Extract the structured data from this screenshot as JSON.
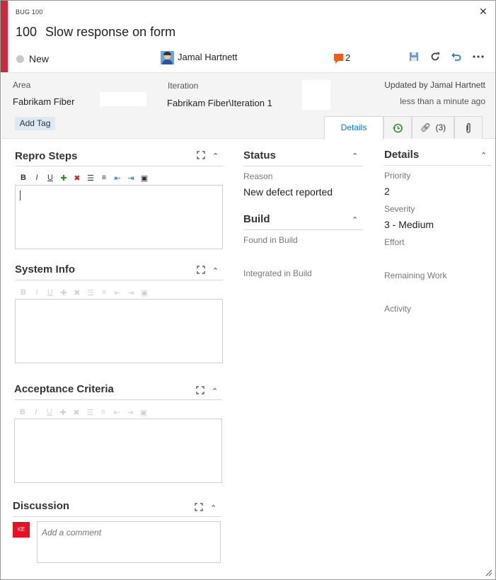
{
  "workitem": {
    "type_label": "BUG 100",
    "id": "100",
    "title": "Slow response on form",
    "state": "New",
    "assigned_to": "Jamal Hartnett",
    "comment_count": "2",
    "accent_color": "#cc293d"
  },
  "toolbar": {
    "close": "✕",
    "icons": [
      "save-icon",
      "refresh-icon",
      "undo-icon",
      "more-icon"
    ]
  },
  "header": {
    "area_label": "Area",
    "area_value": "Fabrikam Fiber",
    "iteration_label": "Iteration",
    "iteration_value": "Fabrikam Fiber\\Iteration 1",
    "updated_by": "Updated by Jamal Hartnett",
    "updated_time": "less than a minute ago",
    "add_tag": "Add Tag"
  },
  "tabs": {
    "details": "Details",
    "links": "(3)"
  },
  "sections": {
    "repro_steps": "Repro Steps",
    "system_info": "System Info",
    "acceptance_criteria": "Acceptance Criteria",
    "discussion": "Discussion"
  },
  "status": {
    "title": "Status",
    "reason_label": "Reason",
    "reason_value": "New defect reported"
  },
  "build": {
    "title": "Build",
    "found_label": "Found in Build",
    "integrated_label": "Integrated in Build"
  },
  "details": {
    "title": "Details",
    "priority_label": "Priority",
    "priority_value": "2",
    "severity_label": "Severity",
    "severity_value": "3 - Medium",
    "effort_label": "Effort",
    "remaining_label": "Remaining Work",
    "activity_label": "Activity"
  },
  "discussion": {
    "user_initials": "KE",
    "placeholder": "Add a comment"
  }
}
